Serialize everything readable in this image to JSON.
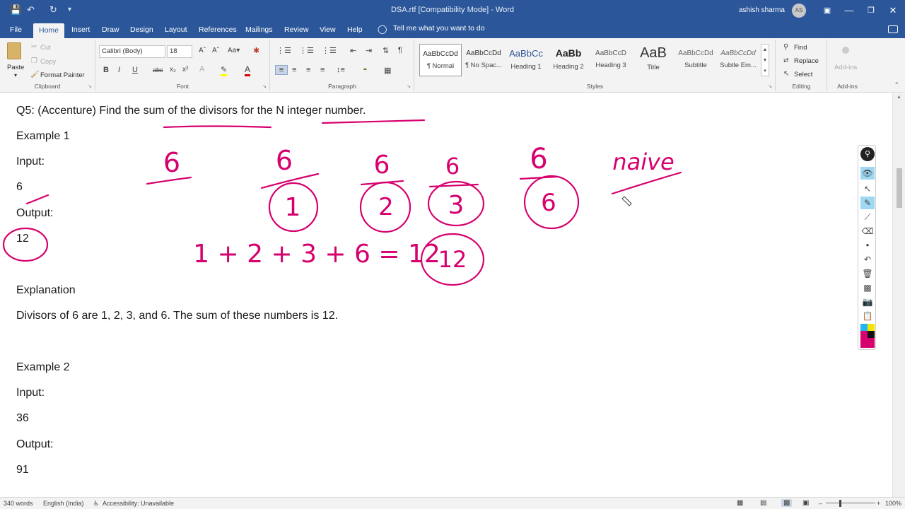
{
  "titlebar": {
    "title": "DSA.rtf [Compatibility Mode]  -  Word",
    "user_name": "ashish sharma",
    "avatar_initials": "AS"
  },
  "tabs": [
    "File",
    "Home",
    "Insert",
    "Draw",
    "Design",
    "Layout",
    "References",
    "Mailings",
    "Review",
    "View",
    "Help"
  ],
  "tell_me": "Tell me what you want to do",
  "ribbon": {
    "clipboard": {
      "label": "Clipboard",
      "paste": "Paste",
      "cut": "Cut",
      "copy": "Copy",
      "format_painter": "Format Painter"
    },
    "font": {
      "label": "Font",
      "font_name": "Calibri (Body)",
      "font_size": "18"
    },
    "paragraph": {
      "label": "Paragraph"
    },
    "styles": {
      "label": "Styles",
      "items": [
        {
          "preview": "AaBbCcDd",
          "name": "¶ Normal"
        },
        {
          "preview": "AaBbCcDd",
          "name": "¶ No Spac..."
        },
        {
          "preview": "AaBbCc",
          "name": "Heading 1"
        },
        {
          "preview": "AaBb",
          "name": "Heading 2"
        },
        {
          "preview": "AaBbCcD",
          "name": "Heading 3"
        },
        {
          "preview": "AaB",
          "name": "Title"
        },
        {
          "preview": "AaBbCcDd",
          "name": "Subtitle"
        },
        {
          "preview": "AaBbCcDd",
          "name": "Subtle Em..."
        }
      ]
    },
    "editing": {
      "label": "Editing",
      "find": "Find",
      "replace": "Replace",
      "select": "Select"
    },
    "addins": {
      "label": "Add-ins",
      "addins_button": "Add-ins"
    }
  },
  "document": {
    "paragraphs": [
      "Q5: (Accenture) Find the sum of the divisors for the N integer number.",
      "Example 1",
      "Input:",
      "6",
      "Output:",
      "12",
      "Explanation",
      "Divisors of 6 are 1, 2, 3, and 6. The sum of these numbers is 12.",
      "Example 2",
      "Input:",
      "36",
      "Output:",
      "91"
    ]
  },
  "ink": {
    "color": "#d6006e",
    "texts": [
      "6",
      "6",
      "6",
      "6",
      "6",
      "1",
      "2",
      "3",
      "6",
      "naive",
      "1 + 2 + 3 + 6 = 12",
      "12"
    ]
  },
  "statusbar": {
    "words": "340 words",
    "language": "English (India)",
    "accessibility": "Accessibility: Unavailable",
    "zoom": "100%"
  }
}
